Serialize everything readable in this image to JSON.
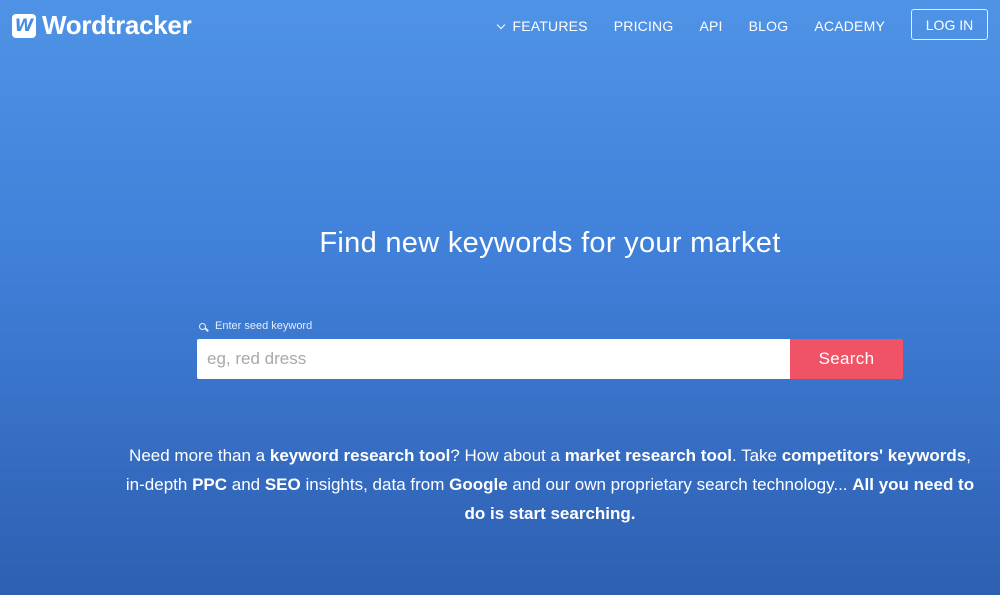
{
  "brand": {
    "logo_letter": "W",
    "name": "Wordtracker"
  },
  "nav": {
    "items": [
      {
        "label": "FEATURES",
        "icon": "chevron-down-icon"
      },
      {
        "label": "PRICING"
      },
      {
        "label": "API"
      },
      {
        "label": "BLOG"
      },
      {
        "label": "ACADEMY"
      }
    ],
    "login_label": "LOG IN"
  },
  "hero": {
    "headline": "Find new keywords for your market"
  },
  "search": {
    "label": "Enter seed keyword",
    "label_icon": "search-icon",
    "placeholder": "eg, red dress",
    "value": "",
    "button_label": "Search"
  },
  "blurb": {
    "p1": "Need more than a ",
    "b1": "keyword research tool",
    "p2": "? How about a ",
    "b2": "market research tool",
    "p3": ". Take ",
    "b3": "competitors' keywords",
    "p4": ", in-depth ",
    "b4": "PPC",
    "p5": " and ",
    "b5": "SEO",
    "p6": " insights, data from ",
    "b6": "Google",
    "p7": " and our own proprietary search technology... ",
    "b7": "All you need to do is start searching."
  },
  "colors": {
    "accent": "#f05266",
    "background_top": "#4f93e6",
    "background_bottom": "#2e5fb1"
  }
}
